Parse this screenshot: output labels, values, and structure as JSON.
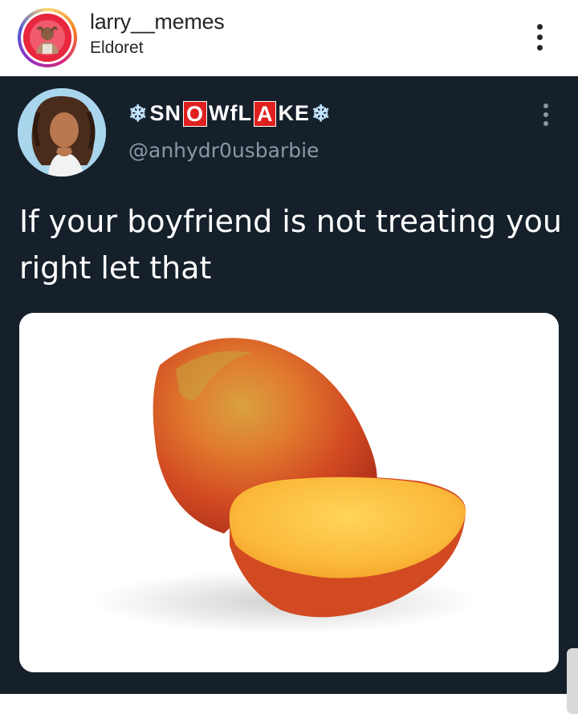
{
  "post": {
    "username": "larry__memes",
    "location": "Eldoret",
    "avatar_icon": "profile-avatar",
    "more_icon": "more-options-icon"
  },
  "tweet": {
    "display_name": {
      "leading_snow": "❄",
      "part1": "SN",
      "boxed1": "O",
      "part2": "WfL",
      "boxed2": "A",
      "part3": "KE",
      "trailing_snow": "❄"
    },
    "handle": "@anhydr0usbarbie",
    "text": "If your boyfriend is not treating you right let that",
    "media_icon": "mango-image",
    "colors": {
      "background": "#15202b",
      "handle": "#8899a6",
      "box": "#e0201f"
    }
  }
}
